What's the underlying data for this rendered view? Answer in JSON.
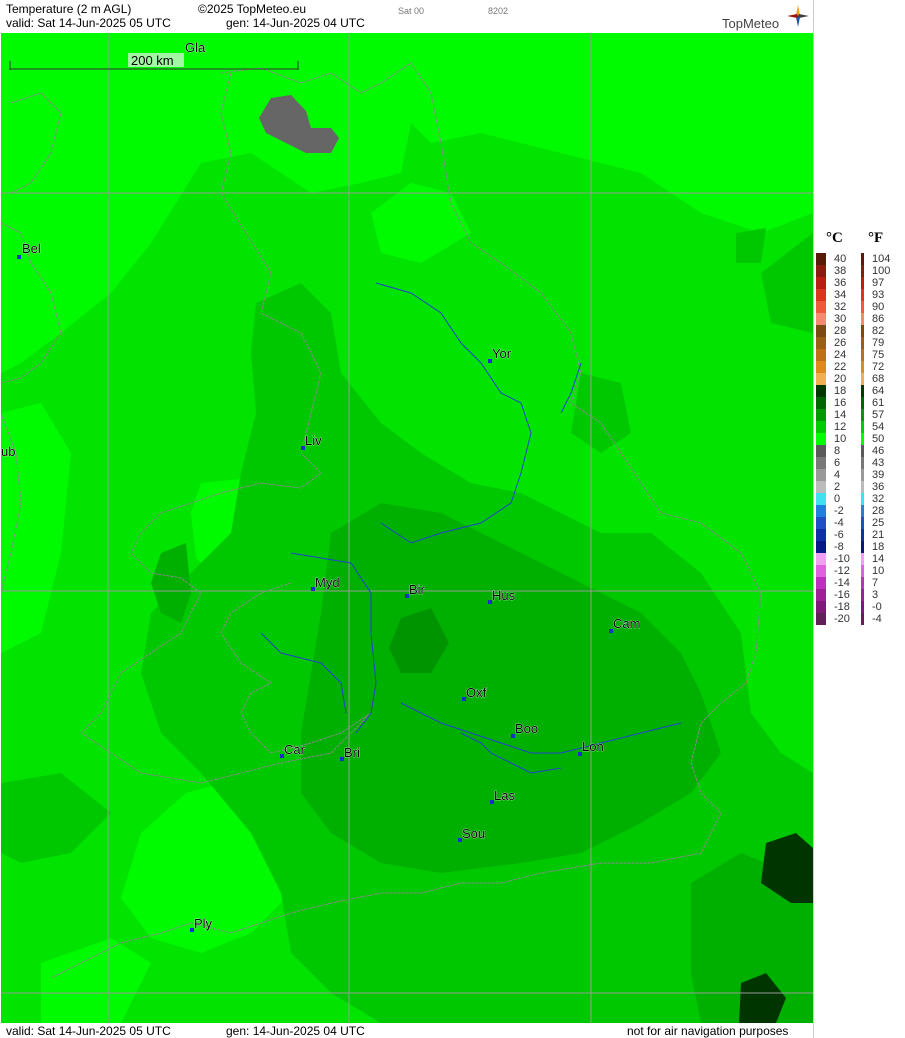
{
  "header": {
    "title": "Temperature (2 m AGL)",
    "copyright": "©2025 TopMeteo.eu",
    "day_code": "Sat 00",
    "run_code": "8202",
    "valid_text": "valid:  Sat  14-Jun-2025  05 UTC",
    "gen_text": "gen: 14-Jun-2025 04 UTC",
    "logo": "TopMeteo"
  },
  "footer": {
    "valid_text": "valid:  Sat  14-Jun-2025  05 UTC",
    "gen_text": "gen: 14-Jun-2025 04 UTC",
    "disclaimer": "not for air navigation purposes"
  },
  "scale_bar": {
    "label": "200 km"
  },
  "cities": [
    {
      "code": "Gla"
    },
    {
      "code": "Bel"
    },
    {
      "code": "Yor"
    },
    {
      "code": "ub"
    },
    {
      "code": "Liv"
    },
    {
      "code": "Myd"
    },
    {
      "code": "Bir"
    },
    {
      "code": "Hus"
    },
    {
      "code": "Cam"
    },
    {
      "code": "Oxf"
    },
    {
      "code": "Boo"
    },
    {
      "code": "Car"
    },
    {
      "code": "Bri"
    },
    {
      "code": "Lon"
    },
    {
      "code": "Las"
    },
    {
      "code": "Sou"
    },
    {
      "code": "Ply"
    }
  ],
  "legend": {
    "celsius_header": "°C",
    "fahrenheit_header": "°F",
    "celsius": [
      "40",
      "38",
      "36",
      "34",
      "32",
      "30",
      "28",
      "26",
      "24",
      "22",
      "20",
      "18",
      "16",
      "14",
      "12",
      "10",
      "8",
      "6",
      "4",
      "2",
      "0",
      "-2",
      "-4",
      "-6",
      "-8",
      "-10",
      "-12",
      "-14",
      "-16",
      "-18",
      "-20"
    ],
    "fahrenheit": [
      "104",
      "100",
      "97",
      "93",
      "90",
      "86",
      "82",
      "79",
      "75",
      "72",
      "68",
      "64",
      "61",
      "57",
      "54",
      "50",
      "46",
      "43",
      "39",
      "36",
      "32",
      "28",
      "25",
      "21",
      "18",
      "14",
      "10",
      "7",
      "3",
      "-0",
      "-4"
    ],
    "colors": [
      "#5a1a0a",
      "#8b1a10",
      "#b81e14",
      "#d9361c",
      "#ee5a3a",
      "#f58a70",
      "#7a4a12",
      "#9a5e14",
      "#c07014",
      "#e08a1c",
      "#f0b050",
      "#003800",
      "#006600",
      "#009900",
      "#00cc00",
      "#00ff00",
      "#5a5a5a",
      "#787878",
      "#999999",
      "#bbbbbb",
      "#40e0f0",
      "#2080e0",
      "#2050c8",
      "#1030a8",
      "#081888",
      "#f0a0f0",
      "#e060e0",
      "#c030c0",
      "#a02098",
      "#801878",
      "#602058"
    ]
  },
  "colors": {
    "base_green": "#00e400",
    "bright_green": "#00fb00",
    "mid_green": "#00c800",
    "dark_green": "#00b000",
    "darkest_green": "#003500",
    "lake_grey": "#666666",
    "river_blue": "#2244cc",
    "city_marker": "#1a2fd0"
  }
}
